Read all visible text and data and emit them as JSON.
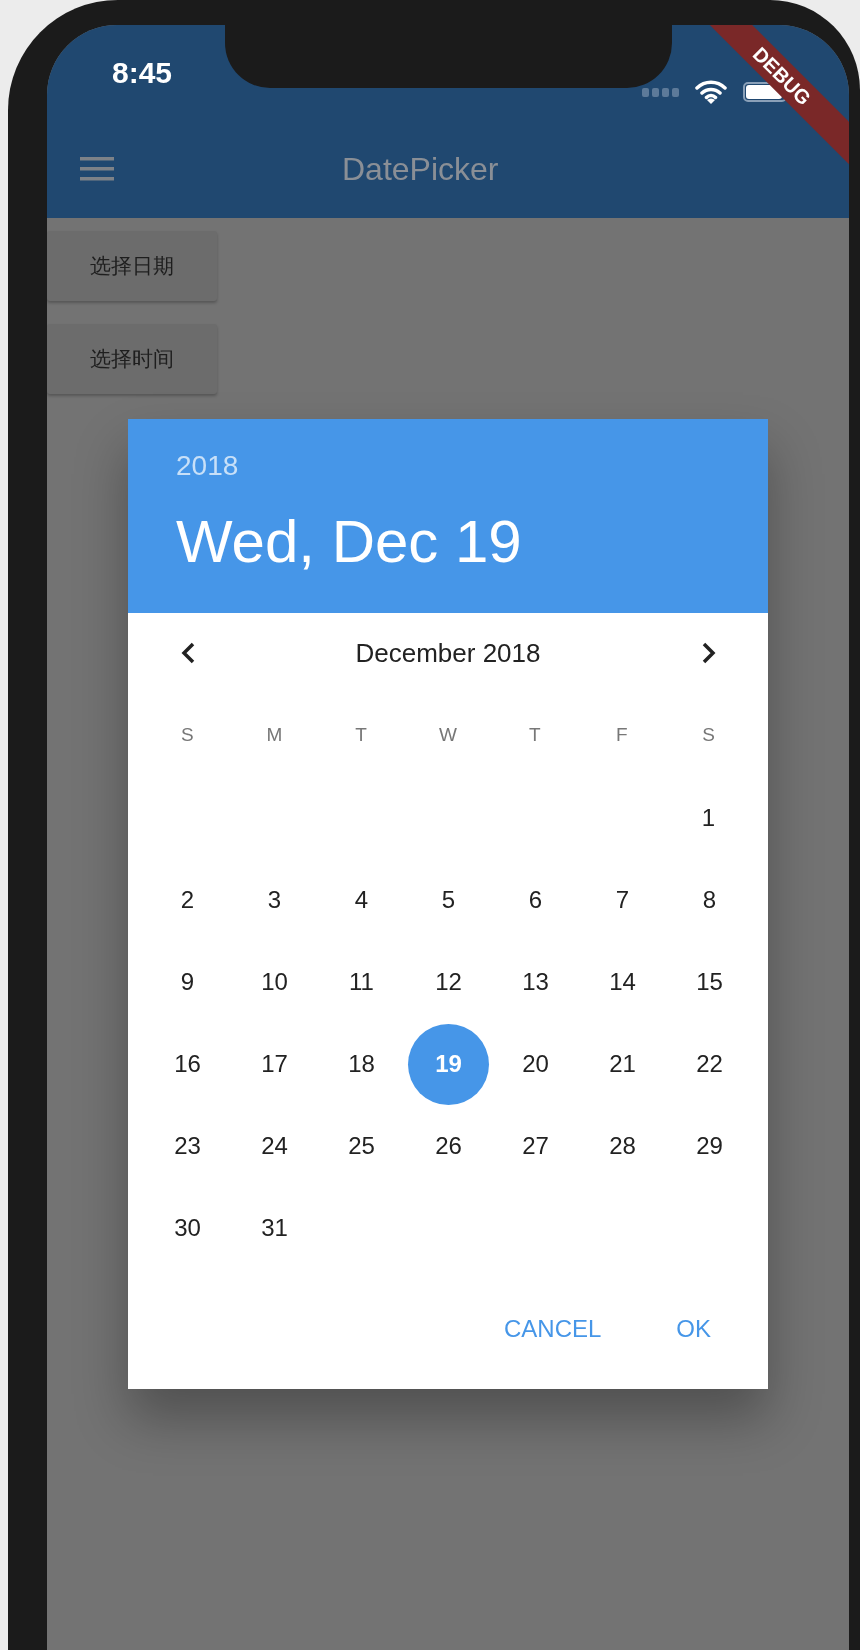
{
  "status_bar": {
    "time": "8:45"
  },
  "app_bar": {
    "title": "DatePicker"
  },
  "debug_banner": "DEBUG",
  "buttons": [
    {
      "label": "选择日期"
    },
    {
      "label": "选择时间"
    }
  ],
  "dialog": {
    "year": "2018",
    "date": "Wed, Dec 19",
    "month": "December 2018",
    "weekdays": [
      "S",
      "M",
      "T",
      "W",
      "T",
      "F",
      "S"
    ],
    "weeks": [
      [
        {
          "label": "1",
          "selected": false
        }
      ],
      [
        {
          "label": "2",
          "selected": false
        },
        {
          "label": "3",
          "selected": false
        },
        {
          "label": "4",
          "selected": false
        },
        {
          "label": "5",
          "selected": false
        },
        {
          "label": "6",
          "selected": false
        },
        {
          "label": "7",
          "selected": false
        },
        {
          "label": "8",
          "selected": false
        }
      ],
      [
        {
          "label": "9",
          "selected": false
        },
        {
          "label": "10",
          "selected": false
        },
        {
          "label": "11",
          "selected": false
        },
        {
          "label": "12",
          "selected": false
        },
        {
          "label": "13",
          "selected": false
        },
        {
          "label": "14",
          "selected": false
        },
        {
          "label": "15",
          "selected": false
        }
      ],
      [
        {
          "label": "16",
          "selected": false
        },
        {
          "label": "17",
          "selected": false
        },
        {
          "label": "18",
          "selected": false
        },
        {
          "label": "19",
          "selected": true
        },
        {
          "label": "20",
          "selected": false
        },
        {
          "label": "21",
          "selected": false
        },
        {
          "label": "22",
          "selected": false
        }
      ],
      [
        {
          "label": "23",
          "selected": false
        },
        {
          "label": "24",
          "selected": false
        },
        {
          "label": "25",
          "selected": false
        },
        {
          "label": "26",
          "selected": false
        },
        {
          "label": "27",
          "selected": false
        },
        {
          "label": "28",
          "selected": false
        },
        {
          "label": "29",
          "selected": false
        }
      ],
      [
        {
          "label": "30",
          "selected": false
        },
        {
          "label": "31",
          "selected": false
        }
      ]
    ],
    "actions": [
      {
        "label": "CANCEL"
      },
      {
        "label": "OK"
      }
    ]
  }
}
